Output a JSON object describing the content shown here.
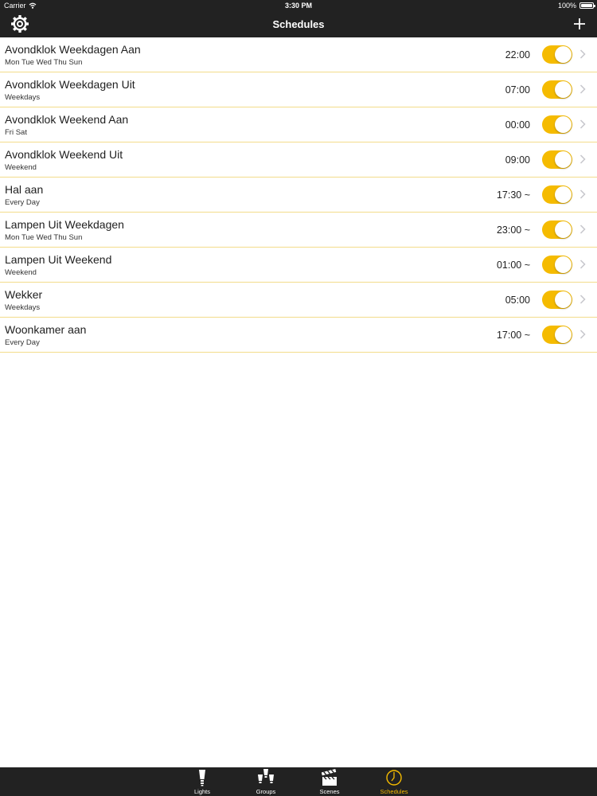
{
  "status_bar": {
    "carrier": "Carrier",
    "time": "3:30 PM",
    "battery": "100%",
    "battery_level": 1.0
  },
  "nav": {
    "title": "Schedules",
    "left_icon": "gear-icon",
    "right_icon": "plus-icon"
  },
  "colors": {
    "accent": "#f5bb00",
    "bar_background": "#222222",
    "separator": "#f3dc8a"
  },
  "schedules": [
    {
      "name": "Avondklok Weekdagen Aan",
      "days": "Mon Tue Wed Thu Sun",
      "time": "22:00",
      "enabled": true
    },
    {
      "name": "Avondklok Weekdagen Uit",
      "days": "Weekdays",
      "time": "07:00",
      "enabled": true
    },
    {
      "name": "Avondklok Weekend Aan",
      "days": "Fri Sat",
      "time": "00:00",
      "enabled": true
    },
    {
      "name": "Avondklok Weekend Uit",
      "days": "Weekend",
      "time": "09:00",
      "enabled": true
    },
    {
      "name": "Hal aan",
      "days": "Every Day",
      "time": "17:30 ~",
      "enabled": true
    },
    {
      "name": "Lampen Uit Weekdagen",
      "days": "Mon Tue Wed Thu Sun",
      "time": "23:00 ~",
      "enabled": true
    },
    {
      "name": "Lampen Uit Weekend",
      "days": "Weekend",
      "time": "01:00 ~",
      "enabled": true
    },
    {
      "name": "Wekker",
      "days": "Weekdays",
      "time": "05:00",
      "enabled": true
    },
    {
      "name": "Woonkamer aan",
      "days": "Every Day",
      "time": "17:00 ~",
      "enabled": true
    }
  ],
  "tabs": [
    {
      "label": "Lights",
      "icon": "bulb-icon",
      "active": false
    },
    {
      "label": "Groups",
      "icon": "group-bulbs-icon",
      "active": false
    },
    {
      "label": "Scenes",
      "icon": "clapperboard-icon",
      "active": false
    },
    {
      "label": "Schedules",
      "icon": "clock-icon",
      "active": true
    }
  ]
}
